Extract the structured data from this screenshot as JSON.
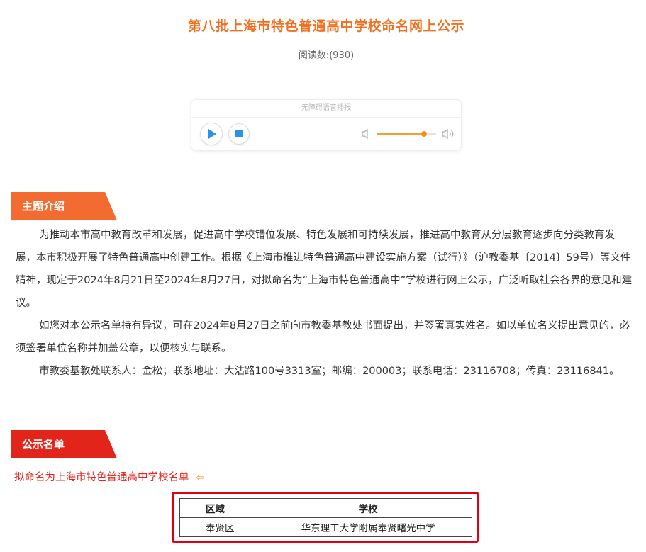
{
  "article": {
    "title": "第八批上海市特色普通高中学校命名网上公示",
    "read_count_label": "阅读数:(930)"
  },
  "player": {
    "header_text": "无障碍语音播报",
    "volume_level": 0.8,
    "play_icon": "play-icon",
    "stop_icon": "stop-icon",
    "volume_low_icon": "volume-low-icon",
    "volume_high_icon": "volume-high-icon"
  },
  "sections": {
    "intro_tab": "主题介绍",
    "list_tab": "公示名单"
  },
  "intro": {
    "p1": "为推动本市高中教育改革和发展，促进高中学校错位发展、特色发展和可持续发展，推进高中教育从分层教育逐步向分类教育发展，本市积极开展了特色普通高中创建工作。根据《上海市推进特色普通高中建设实施方案（试行）》（沪教委基〔2014〕59号）等文件精神，现定于2024年8月21日至2024年8月27日，对拟命名为“上海市特色普通高中”学校进行网上公示，广泛听取社会各界的意见和建议。",
    "p2": "如您对本公示名单持有异议，可在2024年8月27日之前向市教委基教处书面提出，并签署真实姓名。如以单位名义提出意见的，必须签署单位名称并加盖公章，以便核实与联系。",
    "p3": "市教委基教处联系人：金松；联系地址：大沽路100号3313室；邮编：200003；联系电话：23116708；传真：23116841。"
  },
  "list": {
    "subtitle": "拟命名为上海市特色普通高中学校名单",
    "arrow_icon": "arrow-left-icon",
    "headers": [
      "区域",
      "学校"
    ],
    "rows": [
      {
        "district": "奉贤区",
        "school": "华东理工大学附属奉贤曙光中学"
      }
    ]
  },
  "colors": {
    "title": "#f07020",
    "intro_tab": "#f26b30",
    "list_tab": "#e1251b",
    "highlight_box": "#e10010",
    "player_accent": "#2b93e6"
  }
}
